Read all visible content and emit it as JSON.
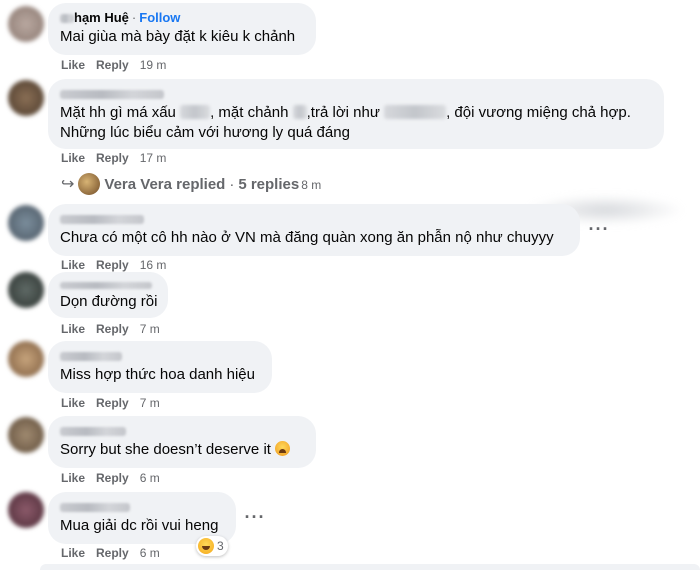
{
  "comments": [
    {
      "author_suffix": "hạm Huệ",
      "follow_label": "Follow",
      "text_parts": [
        "Mai giùa mà bày đặt k kiêu k chảnh"
      ],
      "like_label": "Like",
      "reply_label": "Reply",
      "time": "19 m"
    },
    {
      "text_parts": [
        "Mặt hh gì má xấu",
        ", mặt chảnh",
        ",trả lời như",
        ", đội vương miệng chả hợp."
      ],
      "text_line2": "Những lúc biểu cảm với hương ly quá đáng",
      "like_label": "Like",
      "reply_label": "Reply",
      "time": "17 m",
      "replies": {
        "who": "Vera Vera replied",
        "separator": "·",
        "count_label": "5 replies",
        "time": "8 m"
      }
    },
    {
      "text_parts": [
        "Chưa có một cô hh nào ở VN mà đăng quàn xong ăn phẫn nộ như chuyyy"
      ],
      "more_label": "···",
      "like_label": "Like",
      "reply_label": "Reply",
      "time": "16 m"
    },
    {
      "text_parts": [
        "Dọn đường rồi"
      ],
      "like_label": "Like",
      "reply_label": "Reply",
      "time": "7 m"
    },
    {
      "text_parts": [
        "Miss hợp thức hoa danh hiệu"
      ],
      "like_label": "Like",
      "reply_label": "Reply",
      "time": "7 m"
    },
    {
      "text_parts": [
        "Sorry but she doesn’t deserve it"
      ],
      "like_label": "Like",
      "reply_label": "Reply",
      "time": "6 m"
    },
    {
      "text_parts": [
        "Mua giải dc rồi vui heng"
      ],
      "more_label": "···",
      "like_label": "Like",
      "reply_label": "Reply",
      "time": "6 m",
      "reaction_count": "3"
    }
  ],
  "icons": {
    "reply_arrow": "reply-arrow-icon",
    "crying_emoji": "crying-face-emoji",
    "laughing_emoji": "laughing-face-emoji"
  },
  "colors": {
    "bubble": "#f0f2f5",
    "secondary_text": "#65676b",
    "link_blue": "#1877f2"
  }
}
